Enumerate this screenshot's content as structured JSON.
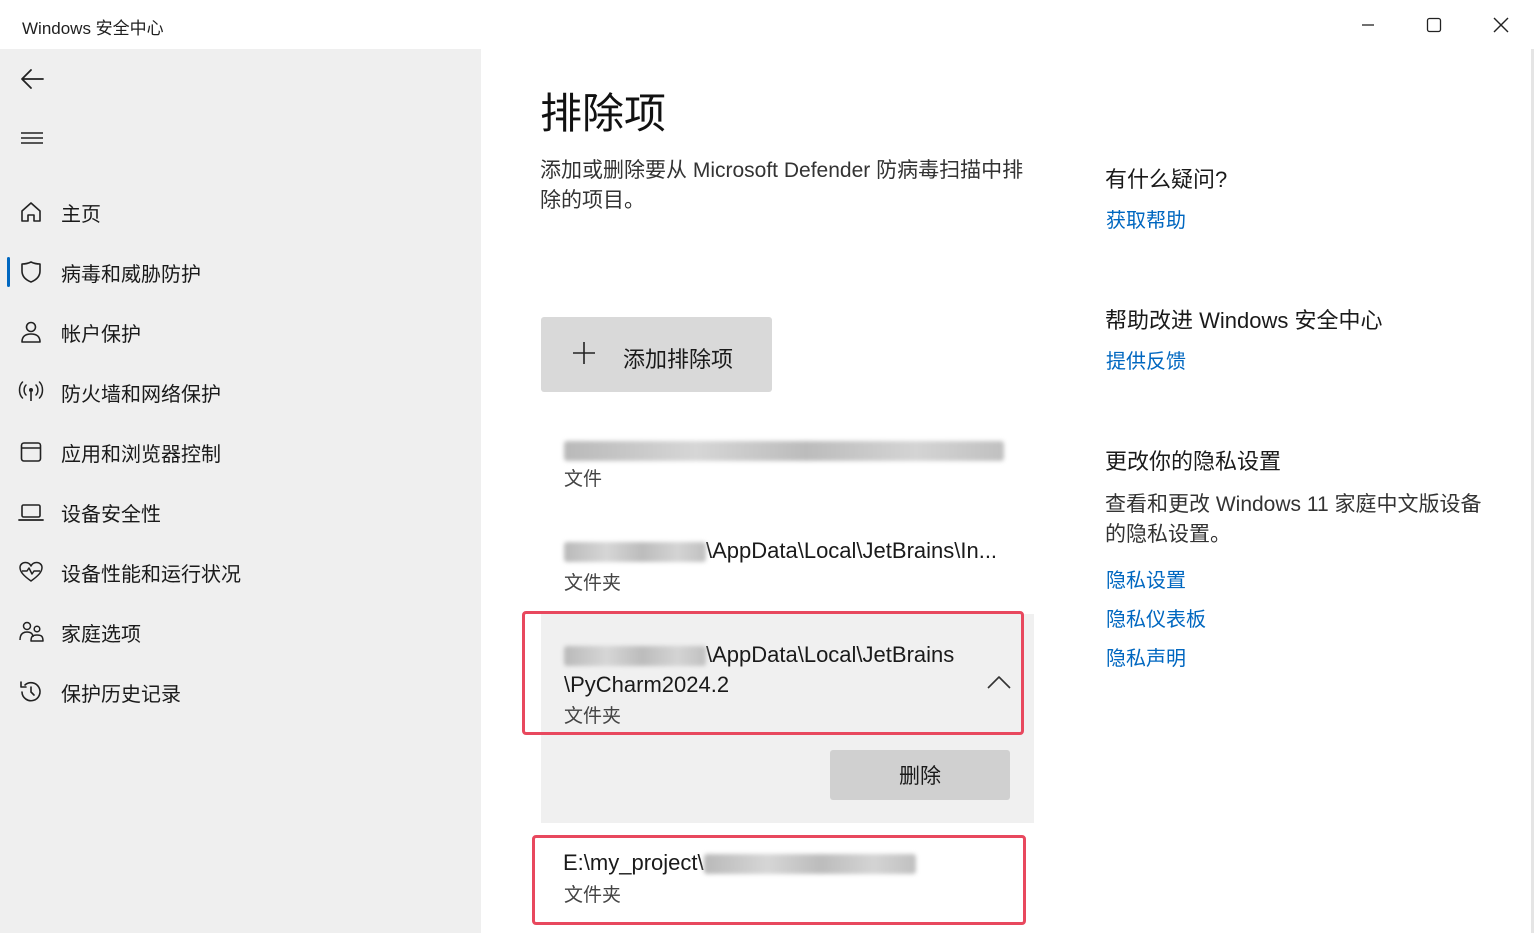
{
  "window": {
    "title": "Windows 安全中心",
    "controls": {
      "minimize": "minimize-icon",
      "maximize": "maximize-icon",
      "close": "close-icon"
    }
  },
  "sidebar": {
    "back_icon": "back-arrow-icon",
    "menu_icon": "hamburger-icon",
    "active_color": "#0067c0",
    "items": [
      {
        "label": "主页",
        "icon": "home-icon"
      },
      {
        "label": "病毒和威胁防护",
        "icon": "shield-icon",
        "active": true
      },
      {
        "label": "帐户保护",
        "icon": "person-icon"
      },
      {
        "label": "防火墙和网络保护",
        "icon": "wireless-icon"
      },
      {
        "label": "应用和浏览器控制",
        "icon": "app-window-icon"
      },
      {
        "label": "设备安全性",
        "icon": "laptop-icon"
      },
      {
        "label": "设备性能和运行状况",
        "icon": "heart-pulse-icon"
      },
      {
        "label": "家庭选项",
        "icon": "family-icon"
      },
      {
        "label": "保护历史记录",
        "icon": "history-icon"
      }
    ]
  },
  "main": {
    "title": "排除项",
    "description": "添加或删除要从 Microsoft Defender 防病毒扫描中排除的项目。",
    "add_button": "添加排除项",
    "delete_button": "删除",
    "exclusions": [
      {
        "path_visible": "",
        "type": "文件"
      },
      {
        "path_visible": "\\AppData\\Local\\JetBrains\\In...",
        "type": "文件夹"
      },
      {
        "path_line1": "\\AppData\\Local\\JetBrains",
        "path_line2": "\\PyCharm2024.2",
        "type": "文件夹",
        "expanded": true
      },
      {
        "path_visible": "E:\\my_project\\",
        "type": "文件夹"
      }
    ],
    "highlight_color": "#e8485e"
  },
  "side_panel": {
    "questions": {
      "heading": "有什么疑问?",
      "link": "获取帮助"
    },
    "improve": {
      "heading": "帮助改进 Windows 安全中心",
      "link": "提供反馈"
    },
    "privacy": {
      "heading": "更改你的隐私设置",
      "text": "查看和更改 Windows 11 家庭中文版设备的隐私设置。",
      "links": [
        "隐私设置",
        "隐私仪表板",
        "隐私声明"
      ]
    },
    "link_color": "#0067c0"
  }
}
